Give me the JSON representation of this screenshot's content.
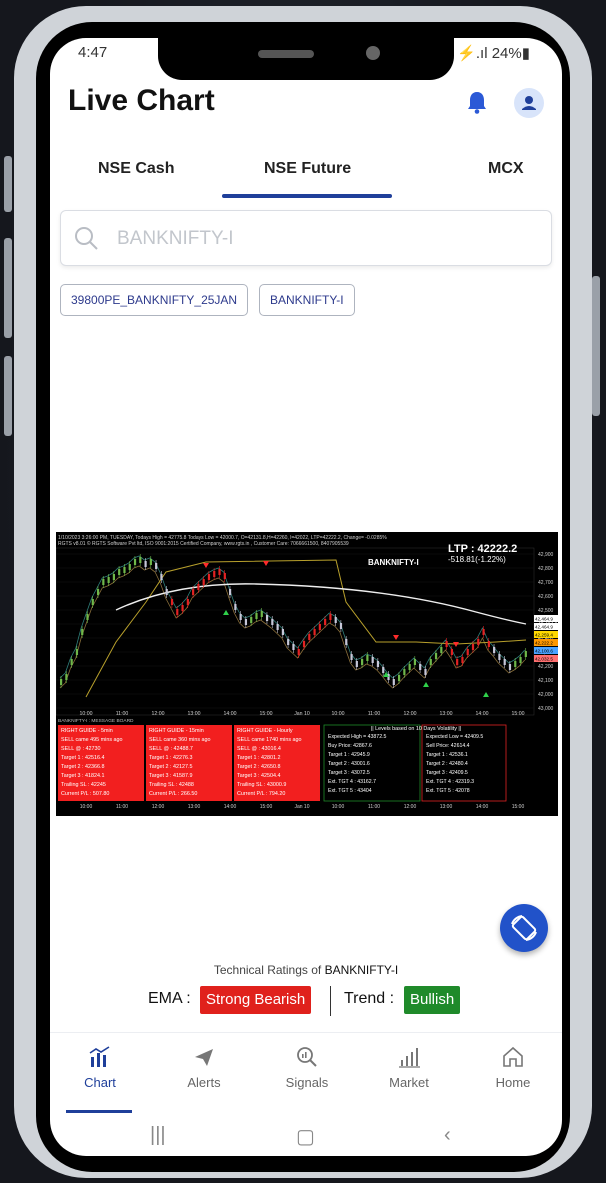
{
  "status": {
    "time": "4:47",
    "right": "⚡.ıl 24%▮"
  },
  "header": {
    "title": "Live Chart"
  },
  "tabs": [
    {
      "label": "NSE Cash"
    },
    {
      "label": "NSE Future"
    },
    {
      "label": "MCX"
    }
  ],
  "search": {
    "placeholder": "BANKNIFTY-I"
  },
  "chips": [
    {
      "label": "39800PE_BANKNIFTY_25JAN"
    },
    {
      "label": "BANKNIFTY-I"
    }
  ],
  "chart": {
    "header_line1": "1/10/2023 3:26:00 PM, TUESDAY, Todays High = 42775.8 Todays Low = 42000.7, O=42131.8,H=42260, l=42022, LTP=42222.2, Change= -0.0285%",
    "header_line2": "RGTS v8.01 © RGTS Software Pvt ltd, ISO 9001:2015 Certified Company, www.rgts.in , Customer Care: 7066661500, 8407905539",
    "ltp": "LTP : 42222.2",
    "change": "-518.81(-1.22%)",
    "symbol": "BANKNIFTY-I",
    "y_ticks": [
      "42,900",
      "42,800",
      "42,700",
      "42,600",
      "42,500",
      "42,464.9",
      "42,400",
      "42,300",
      "42,200",
      "42,100",
      "42,000",
      "43,000"
    ],
    "price_tags": [
      "42,464.9",
      "42,464.9",
      "42,259.4",
      "42,222.2",
      "42,100.6",
      "42,032.5"
    ],
    "x_ticks": [
      "10:00",
      "11:00",
      "12:00",
      "13:00",
      "14:00",
      "15:00",
      "Jan 10",
      "10:00",
      "11:00",
      "12:00",
      "13:00",
      "14:00",
      "15:00"
    ],
    "board_title": "BANKNIFTY-I : MESSAGE BOARD",
    "guides": [
      {
        "title": "RIGHT GUIDE - 5min",
        "l1": "SELL came 495 mins ago",
        "l2": "SELL @ : 42730",
        "l3": "Target 1 : 42516.4",
        "l4": "Target 2 : 42366.8",
        "l5": "Target 3 : 41824.1",
        "l6": "Trailing SL : 42245",
        "l7": "Current P/L : 507.80"
      },
      {
        "title": "RIGHT GUIDE - 15min",
        "l1": "SELL came 360 mins ago",
        "l2": "SELL @ : 42488.7",
        "l3": "Target 1 : 42276.3",
        "l4": "Target 2 : 42127.5",
        "l5": "Target 3 : 41587.9",
        "l6": "Trailing SL : 42488",
        "l7": "Current P/L : 266.50"
      },
      {
        "title": "RIGHT GUIDE - Hourly",
        "l1": "SELL came 1740 mins ago",
        "l2": "SELL @ : 43016.4",
        "l3": "Target 1 : 42801.2",
        "l4": "Target 2 : 42650.8",
        "l5": "Target 3 : 42504.4",
        "l6": "Trailing SL : 43000.9",
        "l7": "Current P/L : 794.20"
      }
    ],
    "levels_title": "|| Levels based on 10 Days Volatility ||",
    "levels_left": [
      "Expected High = 43872.5",
      "Buy Price: 42867.6",
      "Target 1 : 42945.9",
      "Target 2 : 43001.6",
      "Target 3 : 43072.5",
      "Ext. TGT 4 : 43162.7",
      "Ext. TGT 5 : 43404"
    ],
    "levels_right": [
      "Expected Low = 42409.5",
      "Sell Price: 42614.4",
      "Target 1 : 42536.1",
      "Target 2 : 42480.4",
      "Target 3 : 42409.5",
      "Ext. TGT 4 : 42319.3",
      "Ext. TGT 5 : 42078"
    ]
  },
  "ratings": {
    "title_prefix": "Technical Ratings of ",
    "title_symbol": "BANKNIFTY-I",
    "ema_label": "EMA :",
    "ema_value": "Strong Bearish",
    "trend_label": "Trend :",
    "trend_value": "Bullish",
    "colors": {
      "bearish": "#e0211c",
      "bullish": "#1f8a2a"
    }
  },
  "nav": [
    {
      "label": "Chart",
      "icon": "chart-icon"
    },
    {
      "label": "Alerts",
      "icon": "send-icon"
    },
    {
      "label": "Signals",
      "icon": "search-chart-icon"
    },
    {
      "label": "Market",
      "icon": "bar-growth-icon"
    },
    {
      "label": "Home",
      "icon": "home-icon"
    }
  ],
  "colors": {
    "accent": "#1f3f9a",
    "fab": "#2152c9"
  }
}
